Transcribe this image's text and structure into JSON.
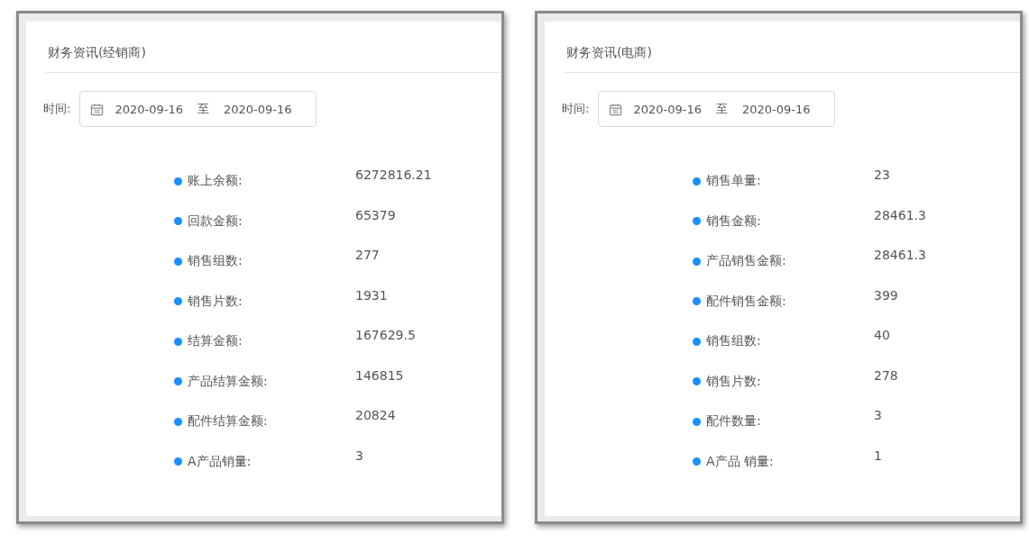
{
  "panels": [
    {
      "title": "财务资讯(经销商)",
      "date_label": "时间:",
      "start_date": "2020-09-16",
      "range_separator": "至",
      "end_date": "2020-09-16",
      "items": [
        {
          "label": "账上余额:",
          "value": "6272816.21",
          "color": "#1890ff"
        },
        {
          "label": "回款金额:",
          "value": "65379",
          "color": "#1890ff"
        },
        {
          "label": "销售组数:",
          "value": "277",
          "color": "#1890ff"
        },
        {
          "label": "销售片数:",
          "value": "1931",
          "color": "#1890ff"
        },
        {
          "label": "结算金额:",
          "value": "167629.5",
          "color": "#1890ff"
        },
        {
          "label": "产品结算金额:",
          "value": "146815",
          "color": "#1890ff"
        },
        {
          "label": "配件结算金额:",
          "value": "20824",
          "color": "#1890ff"
        },
        {
          "label": "A产品销量:",
          "value": "3",
          "color": "#1890ff"
        }
      ]
    },
    {
      "title": "财务资讯(电商)",
      "date_label": "时间:",
      "start_date": "2020-09-16",
      "range_separator": "至",
      "end_date": "2020-09-16",
      "items": [
        {
          "label": "销售单量:",
          "value": "23",
          "color": "#1890ff"
        },
        {
          "label": "销售金额:",
          "value": "28461.3",
          "color": "#1890ff"
        },
        {
          "label": "产品销售金额:",
          "value": "28461.3",
          "color": "#1890ff"
        },
        {
          "label": "配件销售金额:",
          "value": "399",
          "color": "#1890ff"
        },
        {
          "label": "销售组数:",
          "value": "40",
          "color": "#1890ff"
        },
        {
          "label": "销售片数:",
          "value": "278",
          "color": "#1890ff"
        },
        {
          "label": "配件数量:",
          "value": "3",
          "color": "#1890ff"
        },
        {
          "label": "A产品 销量:",
          "value": "1",
          "color": "#1890ff"
        }
      ]
    }
  ]
}
